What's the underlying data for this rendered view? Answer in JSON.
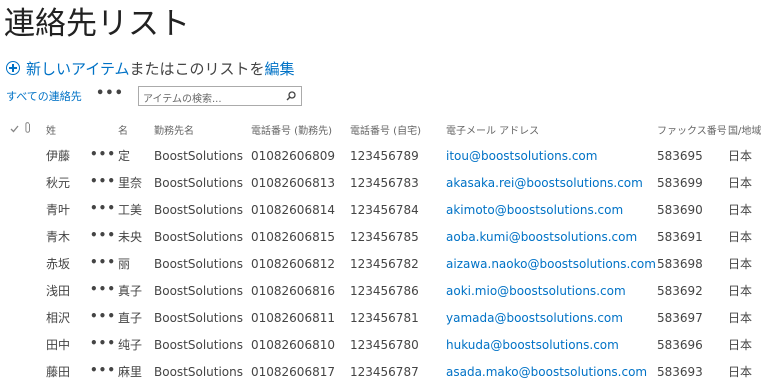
{
  "page": {
    "title": "連絡先リスト",
    "new_item": {
      "link": "新しいアイテム",
      "middle": "またはこのリストを",
      "edit": "編集"
    }
  },
  "view": {
    "name": "すべての連絡先",
    "more": "•••"
  },
  "search": {
    "placeholder": "アイテムの検索..."
  },
  "columns": {
    "last_name": "姓",
    "first_name": "名",
    "company": "勤務先名",
    "business_phone": "電話番号 (勤務先)",
    "home_phone": "電話番号 (自宅)",
    "email": "電子メール アドレス",
    "fax": "ファックス番号",
    "country": "国/地域"
  },
  "row_menu": "•••",
  "rows": [
    {
      "last_name": "伊藤",
      "first_name": "定",
      "company": "BoostSolutions",
      "business_phone": "01082606809",
      "home_phone": "123456789",
      "email": "itou@boostsolutions.com",
      "fax": "583695",
      "country": "日本"
    },
    {
      "last_name": "秋元",
      "first_name": "里奈",
      "company": "BoostSolutions",
      "business_phone": "01082606813",
      "home_phone": "123456783",
      "email": "akasaka.rei@boostsolutions.com",
      "fax": "583699",
      "country": "日本"
    },
    {
      "last_name": "青叶",
      "first_name": "工美",
      "company": "BoostSolutions",
      "business_phone": "01082606814",
      "home_phone": "123456784",
      "email": "akimoto@boostsolutions.com",
      "fax": "583690",
      "country": "日本"
    },
    {
      "last_name": "青木",
      "first_name": "未央",
      "company": "BoostSolutions",
      "business_phone": "01082606815",
      "home_phone": "123456785",
      "email": "aoba.kumi@boostsolutions.com",
      "fax": "583691",
      "country": "日本"
    },
    {
      "last_name": "赤坂",
      "first_name": "丽",
      "company": "BoostSolutions",
      "business_phone": "01082606812",
      "home_phone": "123456782",
      "email": "aizawa.naoko@boostsolutions.com",
      "fax": "583698",
      "country": "日本"
    },
    {
      "last_name": "浅田",
      "first_name": "真子",
      "company": "BoostSolutions",
      "business_phone": "01082606816",
      "home_phone": "123456786",
      "email": "aoki.mio@boostsolutions.com",
      "fax": "583692",
      "country": "日本"
    },
    {
      "last_name": "相沢",
      "first_name": "直子",
      "company": "BoostSolutions",
      "business_phone": "01082606811",
      "home_phone": "123456781",
      "email": "yamada@boostsolutions.com",
      "fax": "583697",
      "country": "日本"
    },
    {
      "last_name": "田中",
      "first_name": "纯子",
      "company": "BoostSolutions",
      "business_phone": "01082606810",
      "home_phone": "123456780",
      "email": "hukuda@boostsolutions.com",
      "fax": "583696",
      "country": "日本"
    },
    {
      "last_name": "藤田",
      "first_name": "麻里",
      "company": "BoostSolutions",
      "business_phone": "01082606817",
      "home_phone": "123456787",
      "email": "asada.mako@boostsolutions.com",
      "fax": "583693",
      "country": "日本"
    }
  ],
  "icons": {
    "check": "check-icon",
    "attachment": "paperclip-icon",
    "search": "magnifier-icon",
    "add": "plus-circle-icon"
  },
  "colors": {
    "link": "#0072c6",
    "text": "#444444",
    "header": "#666666"
  }
}
